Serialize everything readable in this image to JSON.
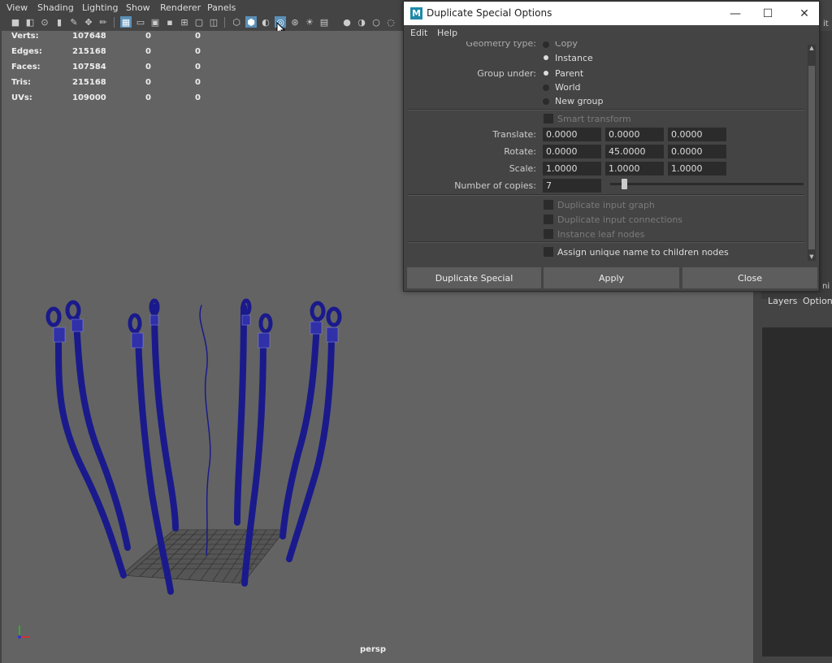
{
  "panel_menu": [
    "View",
    "Shading",
    "Lighting",
    "Show",
    "Renderer",
    "Panels"
  ],
  "hud": {
    "rows": [
      {
        "label": "Verts:",
        "v1": "107648",
        "v2": "0",
        "v3": "0"
      },
      {
        "label": "Edges:",
        "v1": "215168",
        "v2": "0",
        "v3": "0"
      },
      {
        "label": "Faces:",
        "v1": "107584",
        "v2": "0",
        "v3": "0"
      },
      {
        "label": "Tris:",
        "v1": "215168",
        "v2": "0",
        "v3": "0"
      },
      {
        "label": "UVs:",
        "v1": "109000",
        "v2": "0",
        "v3": "0"
      }
    ],
    "camera": "persp"
  },
  "dialog": {
    "title": "Duplicate Special Options",
    "logo": "M",
    "menu": [
      "Edit",
      "Help"
    ],
    "geometry_type_label": "Geometry type:",
    "geometry_copy": "Copy",
    "geometry_instance": "Instance",
    "group_under_label": "Group under:",
    "group_parent": "Parent",
    "group_world": "World",
    "group_new": "New group",
    "smart_transform": "Smart transform",
    "translate_label": "Translate:",
    "translate": [
      "0.0000",
      "0.0000",
      "0.0000"
    ],
    "rotate_label": "Rotate:",
    "rotate": [
      "0.0000",
      "45.0000",
      "0.0000"
    ],
    "scale_label": "Scale:",
    "scale": [
      "1.0000",
      "1.0000",
      "1.0000"
    ],
    "copies_label": "Number of copies:",
    "copies": "7",
    "copies_fraction": 0.06,
    "dup_input_graph": "Duplicate input graph",
    "dup_input_conn": "Duplicate input connections",
    "instance_leaf": "Instance leaf nodes",
    "assign_unique": "Assign unique name to children nodes",
    "buttons": {
      "duplicate": "Duplicate Special",
      "apply": "Apply",
      "close": "Close"
    }
  },
  "right_panel": {
    "layers": "Layers",
    "options": "Option",
    "cut_top": "it",
    "cut_mid": "ni"
  },
  "colors": {
    "viewport": "#636363",
    "rope": "#1a1a8c",
    "accent": "#5a8fb8"
  }
}
